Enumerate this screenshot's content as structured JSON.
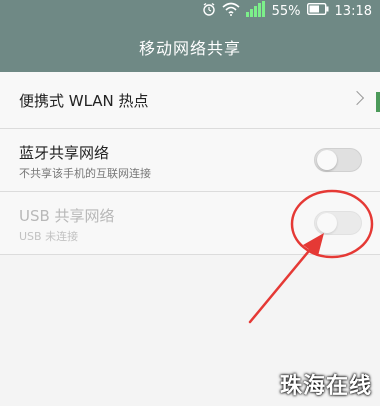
{
  "status_bar": {
    "battery_percent": "55%",
    "time": "13:18",
    "icons": [
      "alarm-icon",
      "wifi-icon",
      "signal-icon",
      "battery-icon"
    ]
  },
  "app_bar": {
    "title": "移动网络共享"
  },
  "settings": [
    {
      "title": "便携式 WLAN 热点",
      "subtitle": "",
      "control": "chevron",
      "enabled": true
    },
    {
      "title": "蓝牙共享网络",
      "subtitle": "不共享该手机的互联网连接",
      "control": "toggle",
      "on": false,
      "enabled": true
    },
    {
      "title": "USB 共享网络",
      "subtitle": "USB 未连接",
      "control": "toggle",
      "on": false,
      "enabled": false
    }
  ],
  "watermark": "珠海在线",
  "colors": {
    "header": "#6f8985",
    "annotation": "#e53935"
  }
}
